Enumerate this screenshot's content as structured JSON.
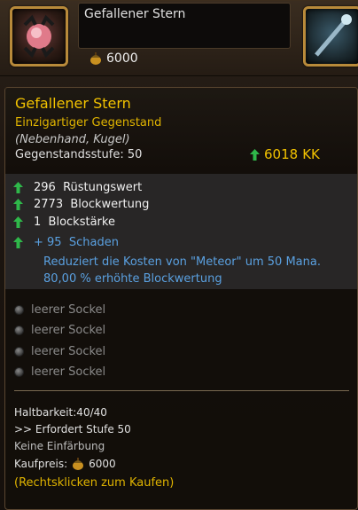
{
  "shop": {
    "item_name": "Gefallener Stern",
    "price": "6000"
  },
  "tooltip": {
    "title": "Gefallener Stern",
    "quality": "Einzigartiger Gegenstand",
    "type": "(Nebenhand, Kugel)",
    "level_label": "Gegenstandsstufe:",
    "level_value": "50",
    "kk_value": "6018",
    "kk_unit": "KK",
    "stats": [
      {
        "value": "296",
        "label": "Rüstungswert"
      },
      {
        "value": "2773",
        "label": "Blockwertung"
      },
      {
        "value": "1",
        "label": "Blockstärke"
      },
      {
        "value": "+ 95",
        "label": "Schaden"
      }
    ],
    "description_1": "Reduziert die Kosten von \"Meteor\" um 50 Mana.",
    "description_2": "80,00 % erhöhte Blockwertung",
    "sockets": [
      "leerer Sockel",
      "leerer Sockel",
      "leerer Sockel",
      "leerer Sockel"
    ],
    "durability": "Haltbarkeit:40/40",
    "requires": ">> Erfordert Stufe 50",
    "dye": "Keine Einfärbung",
    "buy_label": "Kaufpreis:",
    "buy_price": "6000",
    "hint": "(Rechtsklicken zum Kaufen)"
  },
  "colors": {
    "gold": "#f2c200",
    "blue": "#5aa0e0",
    "green_arrow": "#2fb84a"
  }
}
